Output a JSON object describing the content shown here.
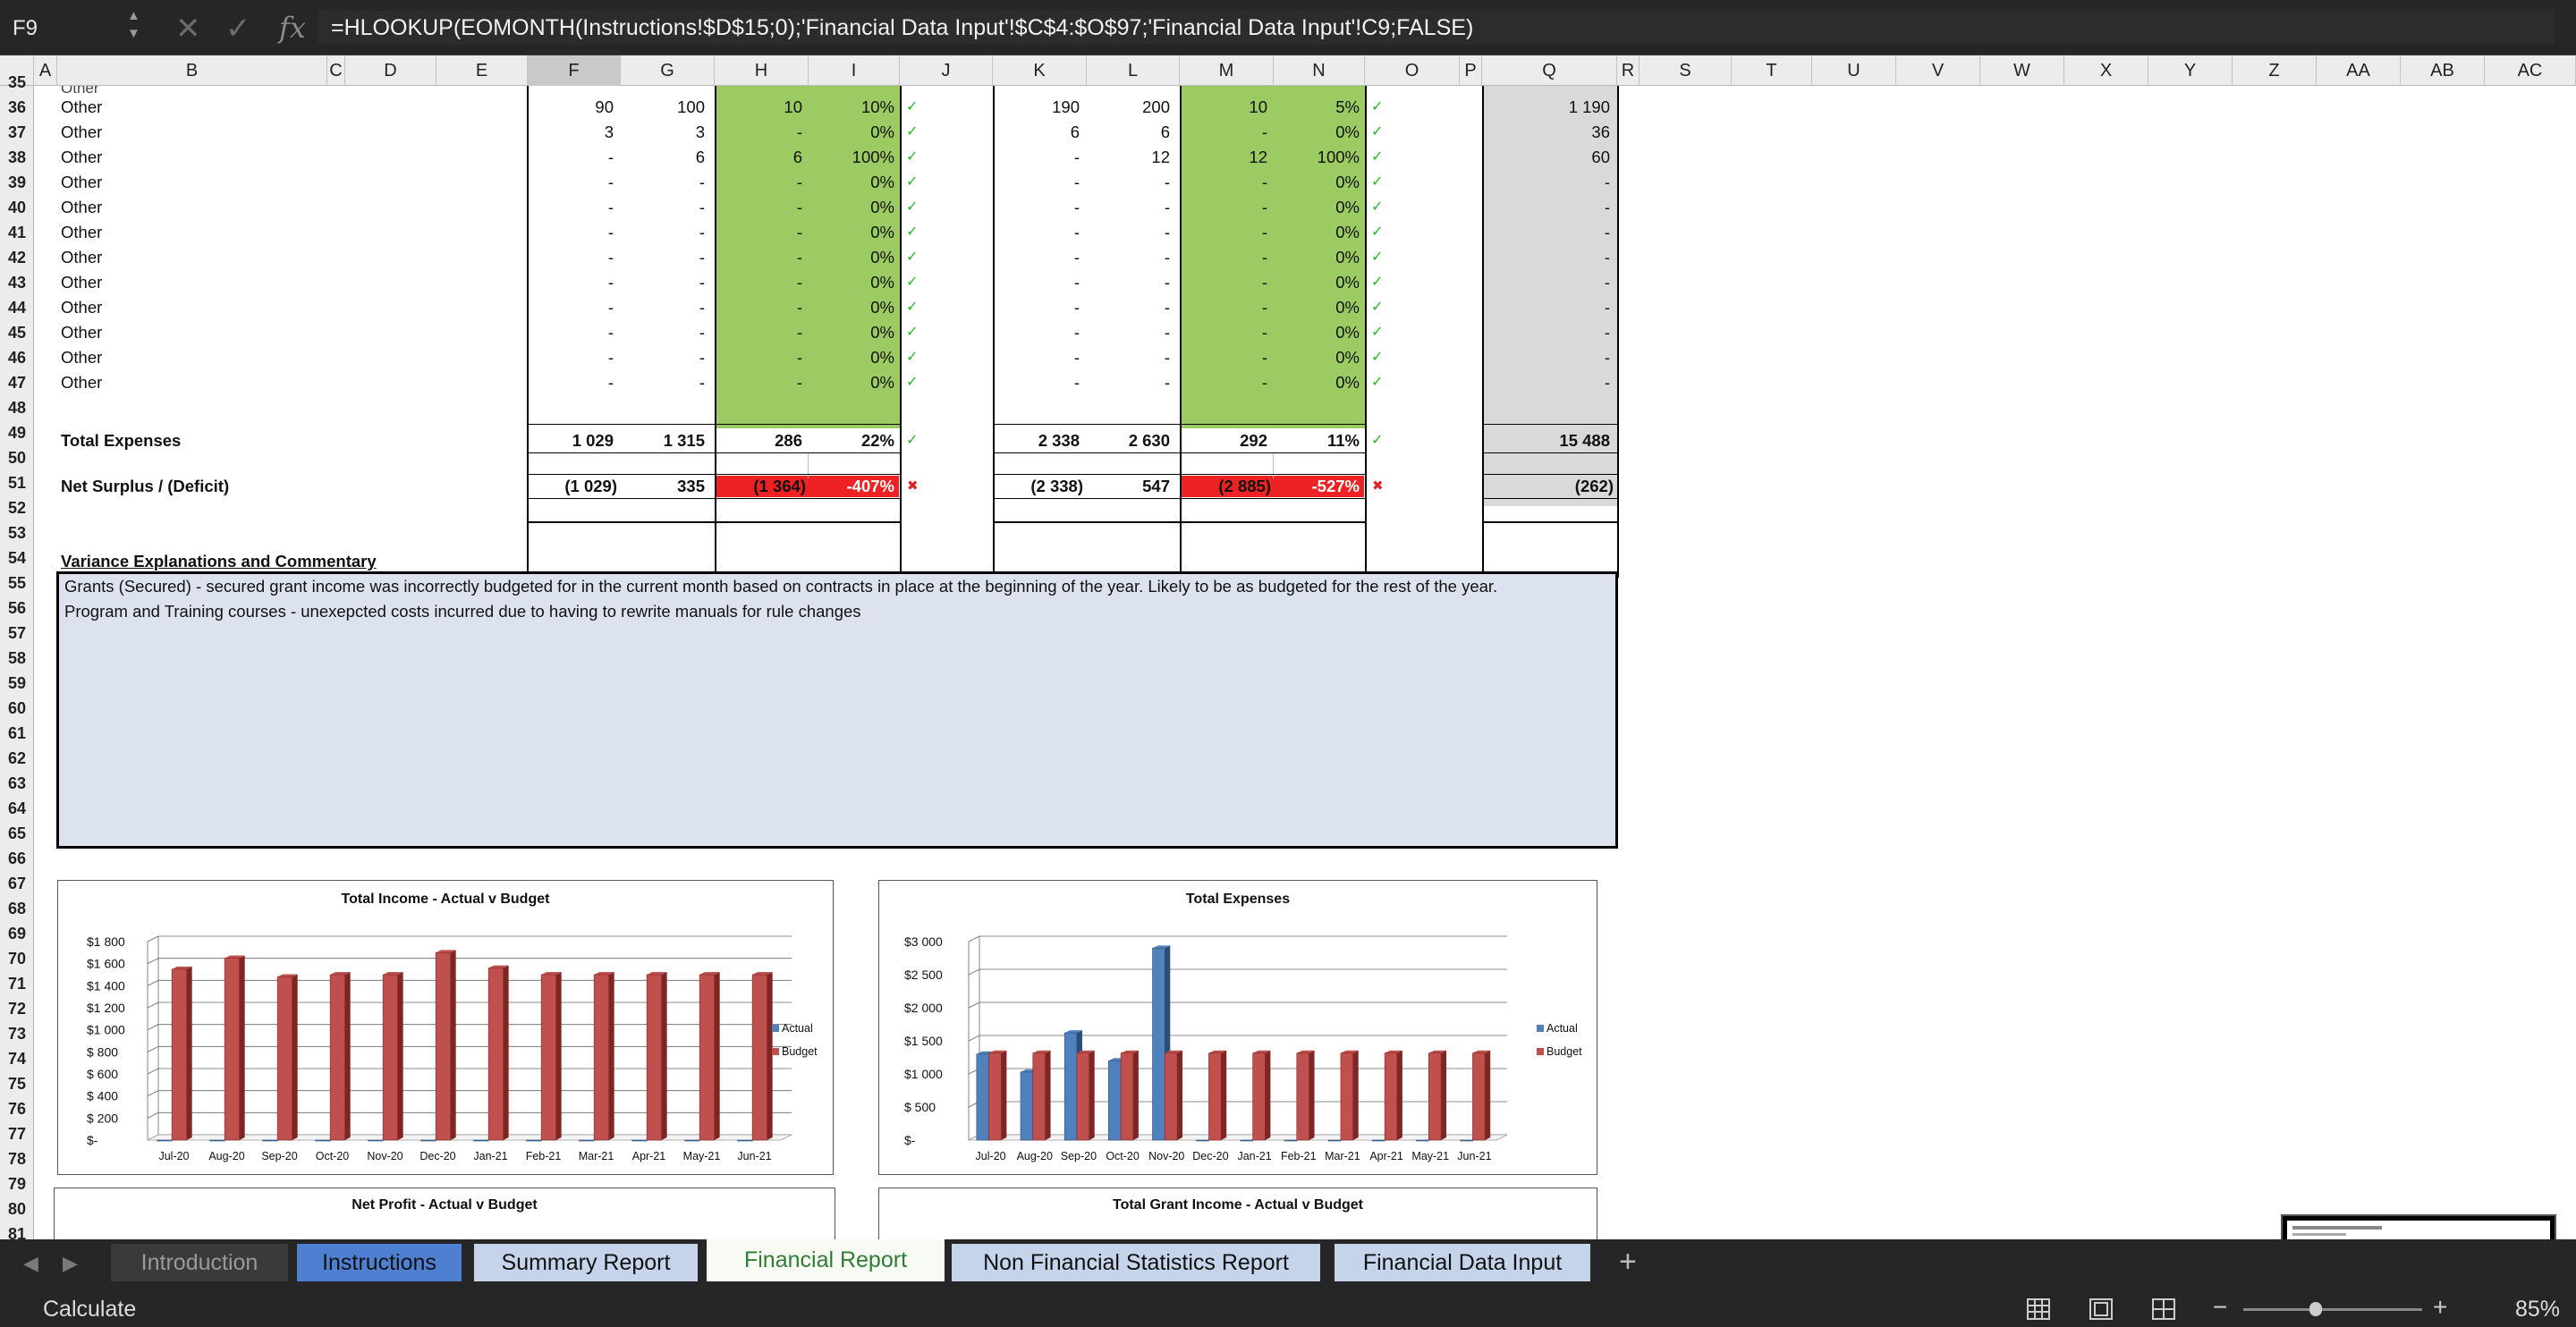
{
  "formula_bar": {
    "name_box": "F9",
    "formula": "=HLOOKUP(EOMONTH(Instructions!$D$15;0);'Financial Data Input'!$C$4:$O$97;'Financial Data Input'!C9;FALSE)"
  },
  "columns": [
    "A",
    "B",
    "C",
    "D",
    "E",
    "F",
    "G",
    "H",
    "I",
    "J",
    "K",
    "L",
    "M",
    "N",
    "O",
    "P",
    "Q",
    "R",
    "S",
    "T",
    "U",
    "V",
    "W",
    "X",
    "Y",
    "Z",
    "AA",
    "AB",
    "AC"
  ],
  "rows": [
    "35",
    "36",
    "37",
    "38",
    "39",
    "40",
    "41",
    "42",
    "43",
    "44",
    "45",
    "46",
    "47",
    "48",
    "49",
    "50",
    "51",
    "52",
    "53",
    "54",
    "55",
    "56",
    "57",
    "58",
    "59",
    "60",
    "61",
    "62",
    "63",
    "64",
    "65",
    "66",
    "67",
    "68",
    "69",
    "70",
    "71",
    "72",
    "73",
    "74",
    "75",
    "76",
    "77",
    "78",
    "79",
    "80",
    "81"
  ],
  "table": {
    "other_rows": [
      {
        "label": "Other",
        "f": "90",
        "g": "100",
        "h": "10",
        "i": "10%",
        "k": "190",
        "l": "200",
        "m": "10",
        "n": "5%",
        "q": "1 190"
      },
      {
        "label": "Other",
        "f": "3",
        "g": "3",
        "h": "-",
        "i": "0%",
        "k": "6",
        "l": "6",
        "m": "-",
        "n": "0%",
        "q": "36"
      },
      {
        "label": "Other",
        "f": "-",
        "g": "6",
        "h": "6",
        "i": "100%",
        "k": "-",
        "l": "12",
        "m": "12",
        "n": "100%",
        "q": "60"
      },
      {
        "label": "Other",
        "f": "-",
        "g": "-",
        "h": "-",
        "i": "0%",
        "k": "-",
        "l": "-",
        "m": "-",
        "n": "0%",
        "q": "-"
      },
      {
        "label": "Other",
        "f": "-",
        "g": "-",
        "h": "-",
        "i": "0%",
        "k": "-",
        "l": "-",
        "m": "-",
        "n": "0%",
        "q": "-"
      },
      {
        "label": "Other",
        "f": "-",
        "g": "-",
        "h": "-",
        "i": "0%",
        "k": "-",
        "l": "-",
        "m": "-",
        "n": "0%",
        "q": "-"
      },
      {
        "label": "Other",
        "f": "-",
        "g": "-",
        "h": "-",
        "i": "0%",
        "k": "-",
        "l": "-",
        "m": "-",
        "n": "0%",
        "q": "-"
      },
      {
        "label": "Other",
        "f": "-",
        "g": "-",
        "h": "-",
        "i": "0%",
        "k": "-",
        "l": "-",
        "m": "-",
        "n": "0%",
        "q": "-"
      },
      {
        "label": "Other",
        "f": "-",
        "g": "-",
        "h": "-",
        "i": "0%",
        "k": "-",
        "l": "-",
        "m": "-",
        "n": "0%",
        "q": "-"
      },
      {
        "label": "Other",
        "f": "-",
        "g": "-",
        "h": "-",
        "i": "0%",
        "k": "-",
        "l": "-",
        "m": "-",
        "n": "0%",
        "q": "-"
      },
      {
        "label": "Other",
        "f": "-",
        "g": "-",
        "h": "-",
        "i": "0%",
        "k": "-",
        "l": "-",
        "m": "-",
        "n": "0%",
        "q": "-"
      },
      {
        "label": "Other",
        "f": "-",
        "g": "-",
        "h": "-",
        "i": "0%",
        "k": "-",
        "l": "-",
        "m": "-",
        "n": "0%",
        "q": "-"
      }
    ],
    "total_expenses": {
      "label": "Total Expenses",
      "f": "1 029",
      "g": "1 315",
      "h": "286",
      "i": "22%",
      "k": "2 338",
      "l": "2 630",
      "m": "292",
      "n": "11%",
      "q": "15 488"
    },
    "net_surplus": {
      "label": "Net Surplus / (Deficit)",
      "f": "(1 029)",
      "g": "335",
      "h": "(1 364)",
      "i": "-407%",
      "k": "(2 338)",
      "l": "547",
      "m": "(2 885)",
      "n": "-527%",
      "q": "(262)"
    }
  },
  "commentary": {
    "title": "Variance Explanations and Commentary",
    "lines": [
      "Grants (Secured) - secured grant income was incorrectly budgeted for in the current month based on contracts in place at the beginning of the year.  Likely to be as budgeted for the rest of the year.",
      "Program and Training courses - unexepcted costs incurred due to having to rewrite manuals for rule changes"
    ]
  },
  "chart_data": [
    {
      "type": "bar",
      "title": "Total Income - Actual v Budget",
      "categories": [
        "Jul-20",
        "Aug-20",
        "Sep-20",
        "Oct-20",
        "Nov-20",
        "Dec-20",
        "Jan-21",
        "Feb-21",
        "Mar-21",
        "Apr-21",
        "May-21",
        "Jun-21"
      ],
      "series": [
        {
          "name": "Actual",
          "values": [
            0,
            0,
            0,
            0,
            0,
            0,
            0,
            0,
            0,
            0,
            0,
            0
          ]
        },
        {
          "name": "Budget",
          "values": [
            1550,
            1650,
            1480,
            1500,
            1500,
            1700,
            1560,
            1500,
            1500,
            1500,
            1500,
            1500
          ]
        }
      ],
      "y_ticks": [
        "$-",
        "$ 200",
        "$ 400",
        "$ 600",
        "$ 800",
        "$1 000",
        "$1 200",
        "$1 400",
        "$1 600",
        "$1 800"
      ],
      "ylim": [
        0,
        1800
      ],
      "legend": "right"
    },
    {
      "type": "bar",
      "title": "Total Expenses",
      "categories": [
        "Jul-20",
        "Aug-20",
        "Sep-20",
        "Oct-20",
        "Nov-20",
        "Dec-20",
        "Jan-21",
        "Feb-21",
        "Mar-21",
        "Apr-21",
        "May-21",
        "Jun-21"
      ],
      "series": [
        {
          "name": "Actual",
          "values": [
            1300,
            1029,
            1620,
            1200,
            2900,
            0,
            0,
            0,
            0,
            0,
            0,
            0
          ]
        },
        {
          "name": "Budget",
          "values": [
            1315,
            1315,
            1315,
            1315,
            1315,
            1315,
            1315,
            1315,
            1315,
            1315,
            1315,
            1315
          ]
        }
      ],
      "y_ticks": [
        "$-",
        "$ 500",
        "$1 000",
        "$1 500",
        "$2 000",
        "$2 500",
        "$3 000"
      ],
      "ylim": [
        0,
        3000
      ],
      "legend": "right"
    },
    {
      "type": "bar",
      "title": "Net Profit - Actual v Budget",
      "categories": [],
      "series": []
    },
    {
      "type": "bar",
      "title": "Total Grant Income - Actual v Budget",
      "categories": [],
      "series": []
    }
  ],
  "sheet_tabs": [
    "Introduction",
    "Instructions",
    "Summary Report",
    "Financial Report",
    "Non Financial Statistics Report",
    "Financial Data Input"
  ],
  "active_tab": "Financial Report",
  "status": {
    "mode": "Calculate",
    "zoom": "85%"
  },
  "colors": {
    "variance_fill": "#9bcb62",
    "deficit_fill": "#ee2222",
    "ytd_fill": "#d9d9d9",
    "commentary_fill": "#dce3ee",
    "actual": "#4f81bd",
    "budget": "#c0504d"
  }
}
